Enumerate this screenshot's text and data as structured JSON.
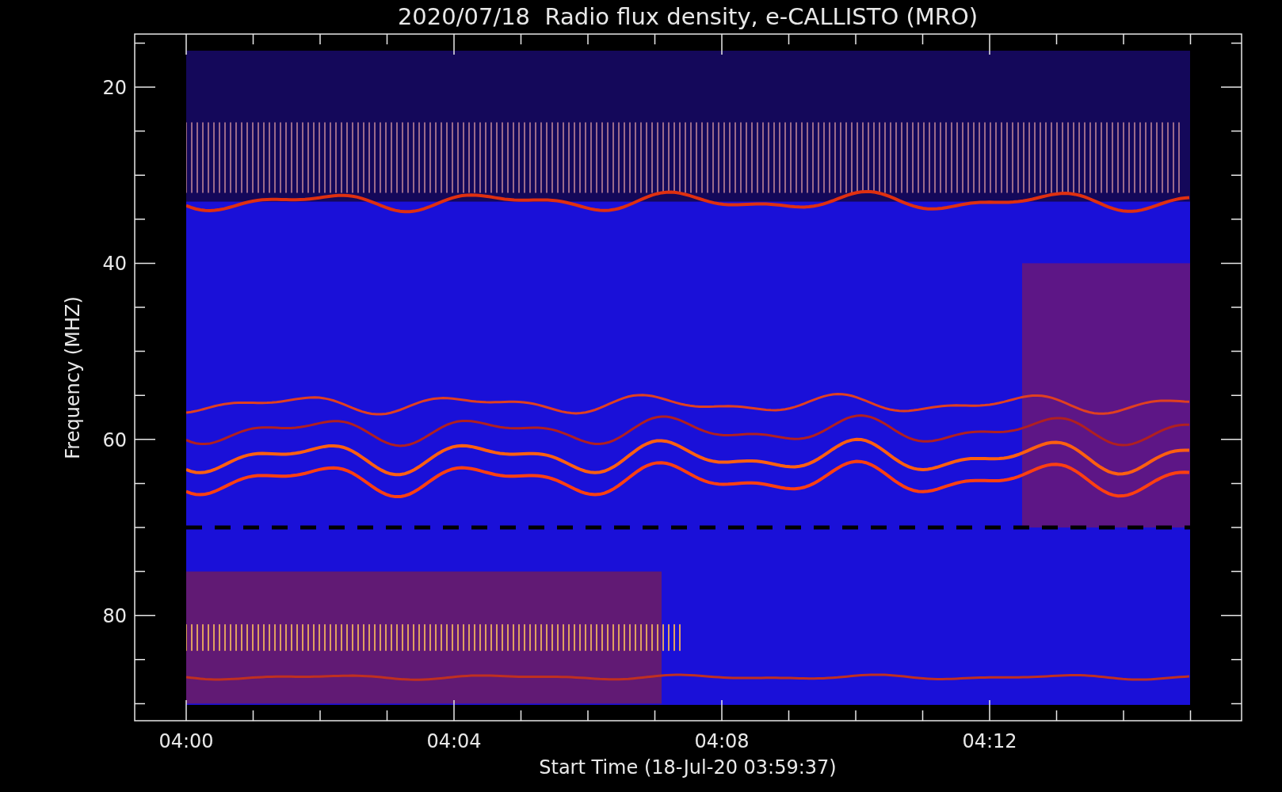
{
  "title": "2020/07/18  Radio flux density, e-CALLISTO (MRO)",
  "y_axis": {
    "label": "Frequency (MHZ)",
    "tick_labels": [
      "20",
      "40",
      "60",
      "80"
    ]
  },
  "x_axis": {
    "label": "Start Time (18-Jul-20 03:59:37)",
    "tick_labels": [
      "04:00",
      "04:04",
      "04:08",
      "04:12"
    ]
  }
}
